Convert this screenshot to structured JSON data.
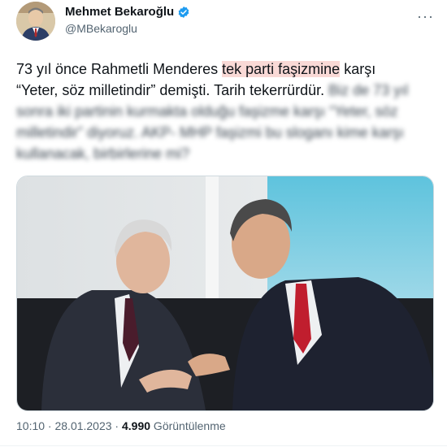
{
  "tweet": {
    "author_name": "Mehmet Bekaroğlu",
    "handle": "@MBekaroglu",
    "more_label": "···",
    "text_line1_pre": "73 yıl önce Rahmetli Menderes ",
    "text_highlight": "tek parti faşizmine",
    "text_line1_post": " karşı",
    "text_line2": "“Yeter, söz milletindir” demişti. Tarih tekerrürdür. ",
    "text_blurred": "Biz de 73 yıl sonra iki partinin kurmakta olduğu faşizme karşı “Yeter, söz milletindir” diyoruz. AKP- MHP faşizmi bu sloganı kime karşı kullanacak, birbirlerine mi?",
    "time": "10:10 · 28.01.2023 · ",
    "views_count": "4.990",
    "views_label": " Görüntülenme"
  },
  "colors": {
    "verified": "#1d9bf0",
    "highlight": "#f9d9d6",
    "secondary_text": "#536471"
  }
}
